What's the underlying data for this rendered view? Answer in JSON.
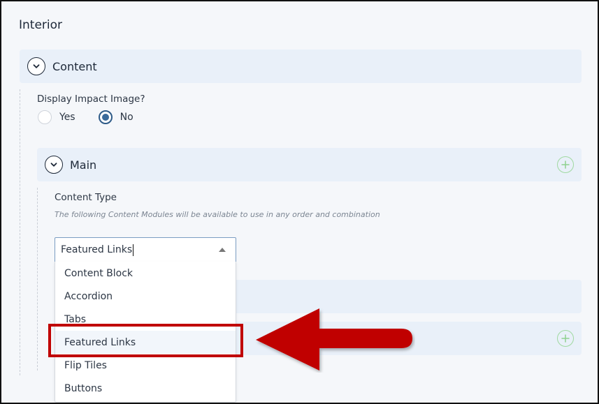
{
  "page": {
    "title": "Interior"
  },
  "content_panel": {
    "title": "Content",
    "toggle_icon": "chevron-down-icon"
  },
  "display_impact_image": {
    "label": "Display Impact Image?",
    "options": [
      {
        "label": "Yes",
        "checked": false
      },
      {
        "label": "No",
        "checked": true
      }
    ]
  },
  "main_panel": {
    "title": "Main",
    "toggle_icon": "chevron-down-icon",
    "add_icon": "plus-circle-icon"
  },
  "content_type": {
    "label": "Content Type",
    "help_text": "The following Content Modules will be available to use in any order and combination",
    "select_value": "Featured Links",
    "options": [
      {
        "label": "Content Block"
      },
      {
        "label": "Accordion"
      },
      {
        "label": "Tabs"
      },
      {
        "label": "Featured Links",
        "hovered": true
      },
      {
        "label": "Flip Tiles"
      },
      {
        "label": "Buttons"
      }
    ]
  },
  "hidden_panels": [
    {
      "add_icon": ""
    },
    {
      "add_icon": "plus-circle-icon"
    }
  ],
  "annotation": {
    "highlight_color": "#c00000",
    "arrow_color": "#c00000",
    "target": "Featured Links"
  }
}
